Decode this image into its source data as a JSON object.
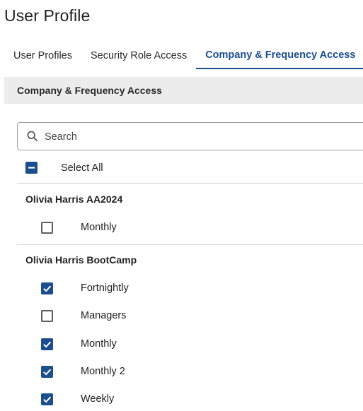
{
  "page": {
    "title": "User Profile"
  },
  "tabs": [
    {
      "label": "User Profiles",
      "active": false
    },
    {
      "label": "Security Role Access",
      "active": false
    },
    {
      "label": "Company & Frequency Access",
      "active": true
    }
  ],
  "panel": {
    "title": "Company & Frequency Access"
  },
  "search": {
    "placeholder": "Search",
    "value": ""
  },
  "select_all": {
    "label": "Select All",
    "state": "indeterminate"
  },
  "colors": {
    "accent": "#1a4e8c",
    "header_bg": "#ececec",
    "divider": "#d6d6d6"
  },
  "groups": [
    {
      "name": "Olivia Harris AA2024",
      "items": [
        {
          "label": "Monthly",
          "checked": false
        }
      ]
    },
    {
      "name": "Olivia Harris BootCamp",
      "items": [
        {
          "label": "Fortnightly",
          "checked": true
        },
        {
          "label": "Managers",
          "checked": false
        },
        {
          "label": "Monthly",
          "checked": true
        },
        {
          "label": "Monthly 2",
          "checked": true
        },
        {
          "label": "Weekly",
          "checked": true
        }
      ]
    }
  ]
}
